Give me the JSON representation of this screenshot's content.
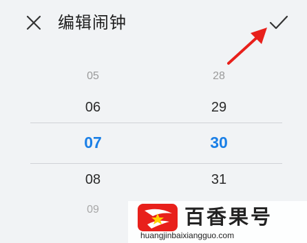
{
  "header": {
    "title": "编辑闹钟",
    "close_icon": "close-icon",
    "confirm_icon": "checkmark-icon"
  },
  "picker": {
    "hours": [
      "05",
      "06",
      "07",
      "08",
      "09"
    ],
    "minutes": [
      "28",
      "29",
      "30",
      "31",
      ""
    ],
    "selected_hour": "07",
    "selected_minute": "30"
  },
  "annotation": {
    "arrow_color": "#e8201b"
  },
  "watermark": {
    "brand": "百香果号",
    "url": "huangjinbaixiangguo.com",
    "logo_color": "#e8201b"
  },
  "colors": {
    "accent": "#1a7fe6",
    "background": "#f1f3f5"
  }
}
